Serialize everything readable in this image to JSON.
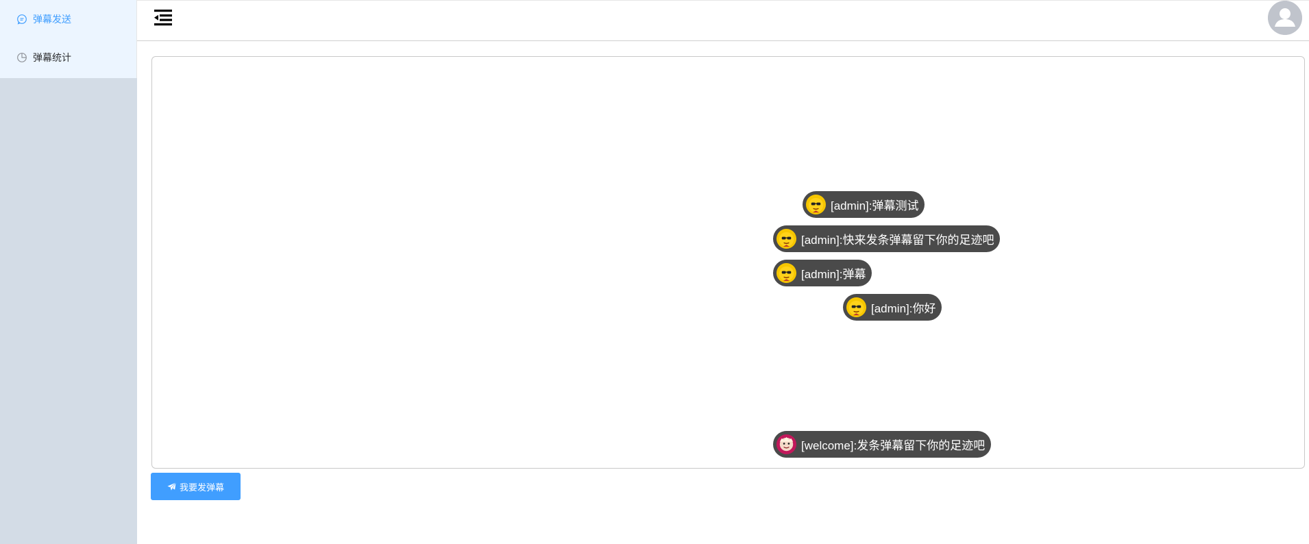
{
  "sidebar": {
    "items": [
      {
        "label": "弹幕发送",
        "icon": "chat-bubble-icon",
        "active": true
      },
      {
        "label": "弹幕统计",
        "icon": "pie-chart-icon",
        "active": false
      }
    ]
  },
  "header": {
    "menu_toggle_icon": "menu-fold-icon",
    "avatar_icon": "user-avatar-icon"
  },
  "danmaku": [
    {
      "text": "[admin]:弹幕测试",
      "avatar": "yellow-face-icon"
    },
    {
      "text": "[admin]:快来发条弹幕留下你的足迹吧",
      "avatar": "yellow-face-icon"
    },
    {
      "text": "[admin]:弹幕",
      "avatar": "yellow-face-icon"
    },
    {
      "text": "[admin]:你好",
      "avatar": "yellow-face-icon"
    },
    {
      "text": "[welcome]:发条弹幕留下你的足迹吧",
      "avatar": "pink-face-icon"
    }
  ],
  "send_button": {
    "label": "我要发弹幕",
    "icon": "paper-plane-icon"
  },
  "colors": {
    "accent": "#409eff",
    "danmu_bg": "#4a4a4a",
    "sidebar_bg": "#d3dce6",
    "menu_bg": "#ecf5ff"
  }
}
